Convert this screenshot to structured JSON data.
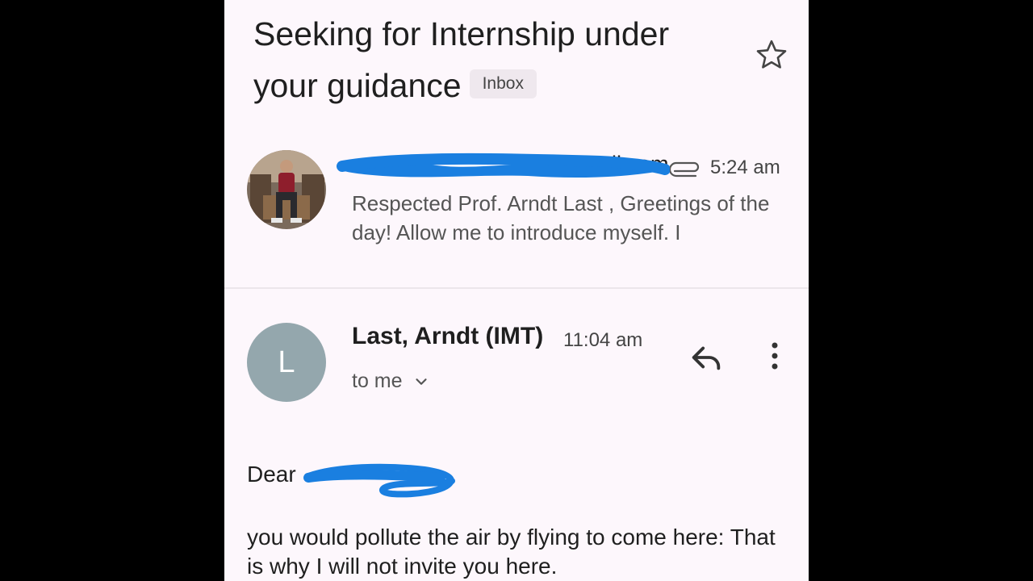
{
  "email": {
    "subject": "Seeking for Internship under your guidance",
    "label": "Inbox"
  },
  "first_message": {
    "sender_visible_tail": "il.com",
    "time": "5:24 am",
    "snippet": "Respected Prof. Arndt Last , Greetings of the day! Allow me to introduce myself. I"
  },
  "second_message": {
    "avatar_letter": "L",
    "sender": "Last, Arndt (IMT)",
    "time": "11:04 am",
    "recipient": "to me",
    "greeting": "Dear",
    "body": "you would pollute the air by flying to come here: That is why I will not invite you here."
  },
  "icons": {
    "star": "star-outline-icon",
    "attachment": "paperclip-icon",
    "reply": "reply-arrow-icon",
    "more": "more-vert-icon",
    "expand": "chevron-down-icon"
  },
  "colors": {
    "background": "#fdf7fc",
    "redaction": "#1a7fe0",
    "letter_avatar": "#94a7ad",
    "chip": "#efe8ee"
  }
}
